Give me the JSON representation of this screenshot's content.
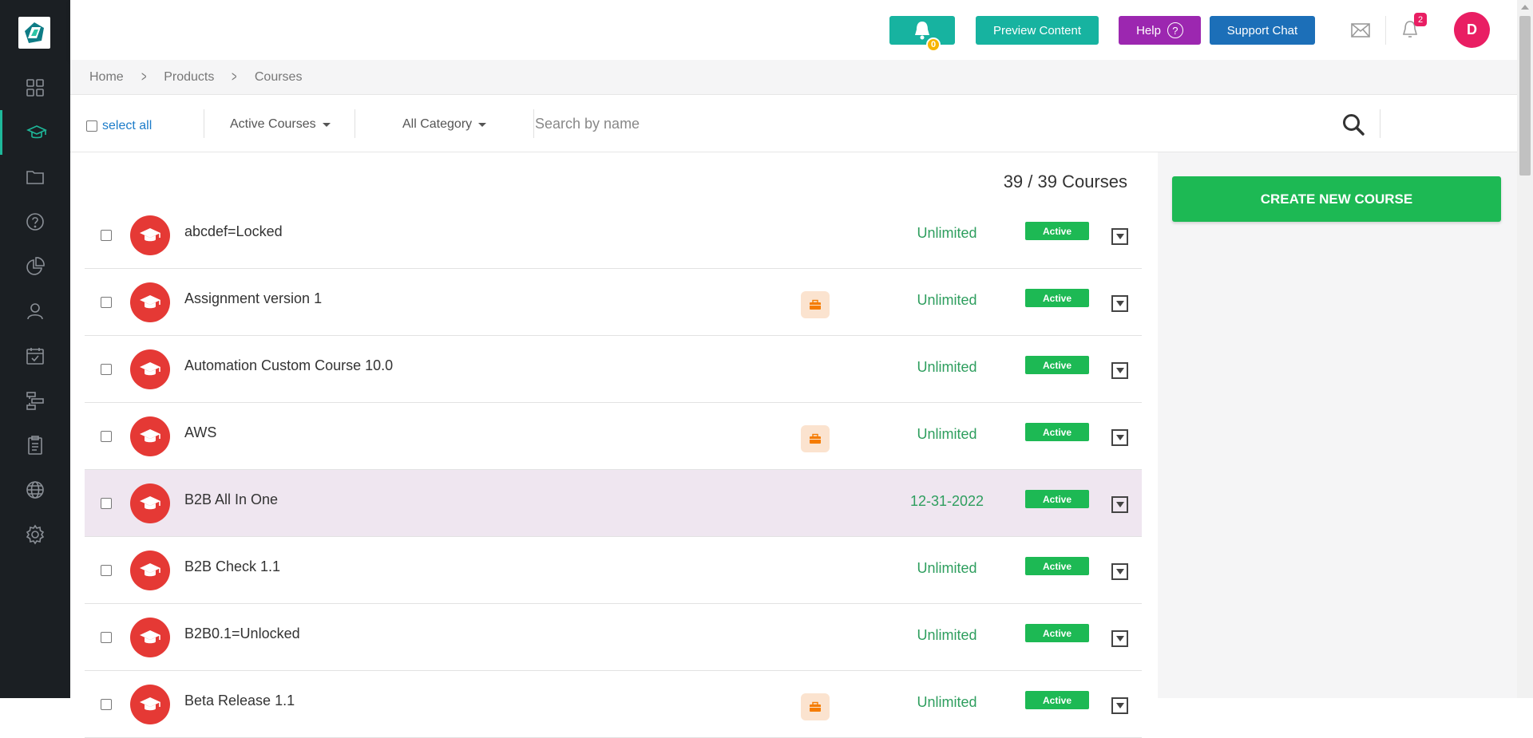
{
  "header": {
    "bell_count": "0",
    "preview_label": "Preview Content",
    "help_label": "Help",
    "help_glyph": "?",
    "support_label": "Support Chat",
    "notification_count": "2",
    "avatar_initial": "D"
  },
  "sidebar": {
    "logo_icon": "logo-icon",
    "items": [
      {
        "icon": "dashboard-icon",
        "active": false
      },
      {
        "icon": "graduation-cap-icon",
        "active": true
      },
      {
        "icon": "folder-icon",
        "active": false
      },
      {
        "icon": "question-icon",
        "active": false
      },
      {
        "icon": "pie-chart-icon",
        "active": false
      },
      {
        "icon": "user-icon",
        "active": false
      },
      {
        "icon": "calendar-check-icon",
        "active": false
      },
      {
        "icon": "sitemap-icon",
        "active": false
      },
      {
        "icon": "clipboard-icon",
        "active": false
      },
      {
        "icon": "globe-icon",
        "active": false
      },
      {
        "icon": "gear-icon",
        "active": false
      }
    ]
  },
  "breadcrumb": {
    "items": [
      "Home",
      "Products",
      "Courses"
    ]
  },
  "filters": {
    "select_all_label": "select all",
    "status_filter": "Active Courses",
    "category_filter": "All Category",
    "search_placeholder": "Search by name"
  },
  "course_count": "39 / 39 Courses",
  "create_button_label": "CREATE NEW COURSE",
  "courses": [
    {
      "name": "abcdef=Locked",
      "validity": "Unlimited",
      "status": "Active",
      "has_brief": false,
      "highlight": false
    },
    {
      "name": "Assignment version 1",
      "validity": "Unlimited",
      "status": "Active",
      "has_brief": true,
      "highlight": false
    },
    {
      "name": "Automation Custom Course 10.0",
      "validity": "Unlimited",
      "status": "Active",
      "has_brief": false,
      "highlight": false
    },
    {
      "name": "AWS",
      "validity": "Unlimited",
      "status": "Active",
      "has_brief": true,
      "highlight": false
    },
    {
      "name": "B2B All In One",
      "validity": "12-31-2022",
      "status": "Active",
      "has_brief": false,
      "highlight": true
    },
    {
      "name": "B2B Check 1.1",
      "validity": "Unlimited",
      "status": "Active",
      "has_brief": false,
      "highlight": false
    },
    {
      "name": "B2B0.1=Unlocked",
      "validity": "Unlimited",
      "status": "Active",
      "has_brief": false,
      "highlight": false
    },
    {
      "name": "Beta Release 1.1",
      "validity": "Unlimited",
      "status": "Active",
      "has_brief": true,
      "highlight": false
    }
  ],
  "colors": {
    "sidebar_bg": "#1b1f23",
    "accent_teal": "#17b3a0",
    "help_purple": "#9c27b0",
    "support_blue": "#1c6fb8",
    "status_green": "#1db954",
    "course_icon_red": "#e53935",
    "highlight_row": "#efe6f0"
  }
}
